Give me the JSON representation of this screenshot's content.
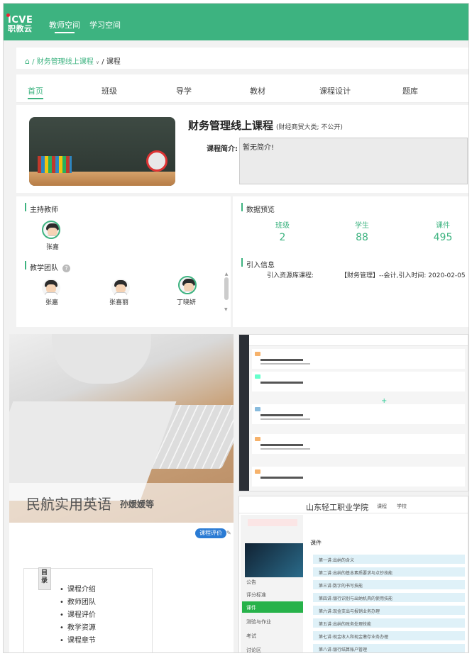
{
  "header": {
    "logo_top": "ICVE",
    "logo_bottom": "职教云",
    "nav": [
      "教师空间",
      "学习空间"
    ]
  },
  "breadcrumb": {
    "parent": "/ 财务管理线上课程",
    "current": "/ 课程"
  },
  "tabs": [
    "首页",
    "班级",
    "导学",
    "教材",
    "课程设计",
    "题库"
  ],
  "course": {
    "title": "财务管理线上课程",
    "subtitle": "(财经商贸大类; 不公开)",
    "desc_label": "课程简介:",
    "desc": "暂无简介!"
  },
  "lead_teacher": {
    "heading": "主持教师",
    "name": "张嘉"
  },
  "team": {
    "heading": "教学团队",
    "help": "?",
    "members": [
      "张嘉",
      "张喜丽",
      "丁晓妍"
    ]
  },
  "stats": {
    "heading": "数据预览",
    "items": [
      {
        "label": "班级",
        "value": "2"
      },
      {
        "label": "学生",
        "value": "88"
      },
      {
        "label": "课件",
        "value": "495"
      }
    ]
  },
  "import_info": {
    "heading": "引入信息",
    "label": "引入资源库课程:",
    "value": "【财务管理】--会计,引入时间: 2020-02-05"
  },
  "english_course": {
    "title": "民航实用英语",
    "teacher": "孙媛媛等",
    "eval_button": "课程评价",
    "toc_tag": "目录",
    "toc": [
      "课程介绍",
      "教师团队",
      "课程评价",
      "教学资源",
      "课程章节"
    ]
  },
  "school_page": {
    "school": "山东轻工职业学院",
    "nav": [
      "课程",
      "学校"
    ],
    "menu": [
      "公告",
      "评分标准",
      "课件",
      "测验与作业",
      "考试",
      "讨论区"
    ],
    "section": "课件",
    "chapters": [
      "第一讲:出纳的含义",
      "第二讲:出纳的基本素质要求与点钞技能",
      "第三讲:数字的书写技能",
      "第四讲:银行识别与出纳机具的使用技能",
      "第六讲:现金支出与报销业务办理",
      "第五讲:出纳的账务处理技能",
      "第七讲:现金收入和现金缴存业务办理",
      "第八讲:银行结算账户管理"
    ]
  },
  "colors": {
    "accent": "#3db380",
    "badge": "#2a7bd4"
  }
}
